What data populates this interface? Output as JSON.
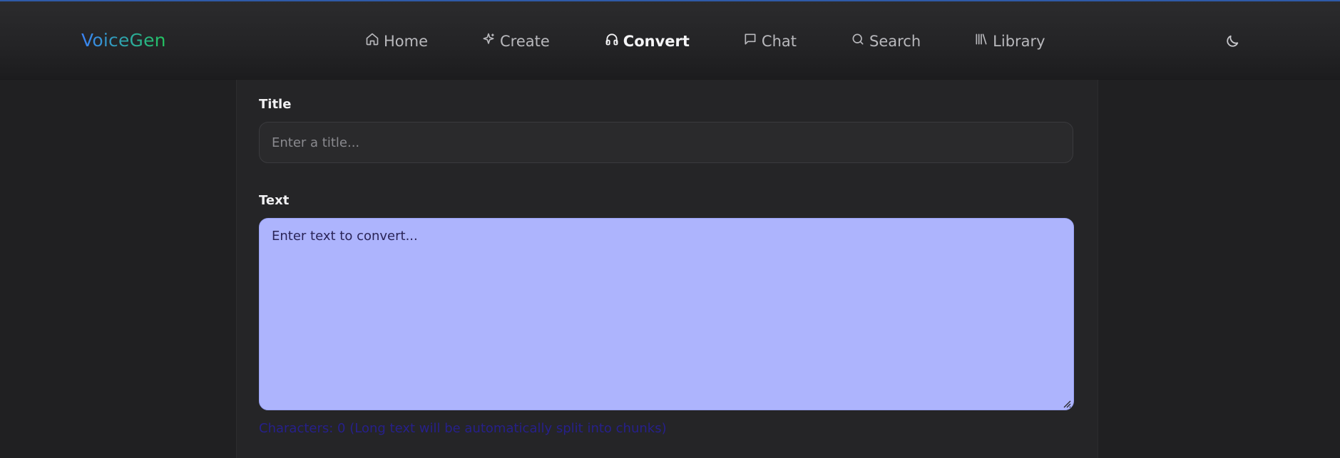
{
  "app": {
    "logo": "VoiceGen"
  },
  "nav": {
    "items": [
      {
        "label": "Home",
        "icon": "home-icon",
        "active": false
      },
      {
        "label": "Create",
        "icon": "sparkle-icon",
        "active": false
      },
      {
        "label": "Convert",
        "icon": "headphones-icon",
        "active": true
      },
      {
        "label": "Chat",
        "icon": "chat-icon",
        "active": false
      },
      {
        "label": "Search",
        "icon": "search-icon",
        "active": false
      },
      {
        "label": "Library",
        "icon": "library-icon",
        "active": false
      }
    ],
    "theme_toggle_icon": "moon-icon"
  },
  "form": {
    "title_label": "Title",
    "title_placeholder": "Enter a title...",
    "title_value": "",
    "text_label": "Text",
    "text_placeholder": "Enter text to convert...",
    "text_value": "",
    "char_count_text": "Characters: 0 (Long text will be automatically split into chunks)"
  },
  "colors": {
    "accent_blue": "#3b82f6",
    "accent_green": "#22c55e",
    "textarea_fill": "#adb4fd",
    "char_count": "#26208a"
  }
}
